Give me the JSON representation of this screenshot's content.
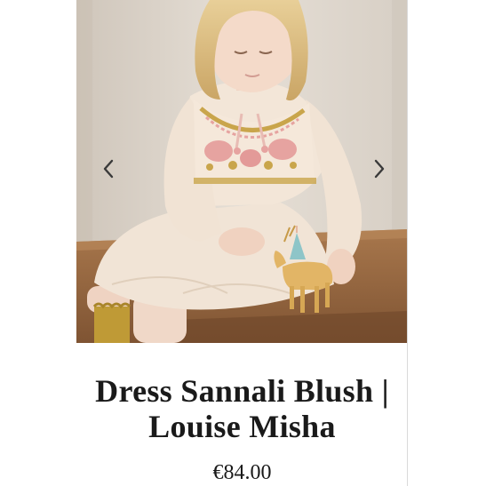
{
  "product": {
    "title_line1": "Dress Sannali Blush |",
    "title_line2": "Louise Misha",
    "price": "€84.00",
    "image_alt": "Child wearing embroidered dress sitting on a wooden bench"
  },
  "carousel": {
    "prev_icon": "chevron-left-icon",
    "next_icon": "chevron-right-icon"
  },
  "colors": {
    "arrow": "#3a3a3a",
    "wall": "#e3dcd3",
    "dress": "#f1e4d6",
    "embroidery_pink": "#e6a3a0",
    "embroidery_gold": "#c9a54b",
    "bench": "#9b6a42"
  }
}
